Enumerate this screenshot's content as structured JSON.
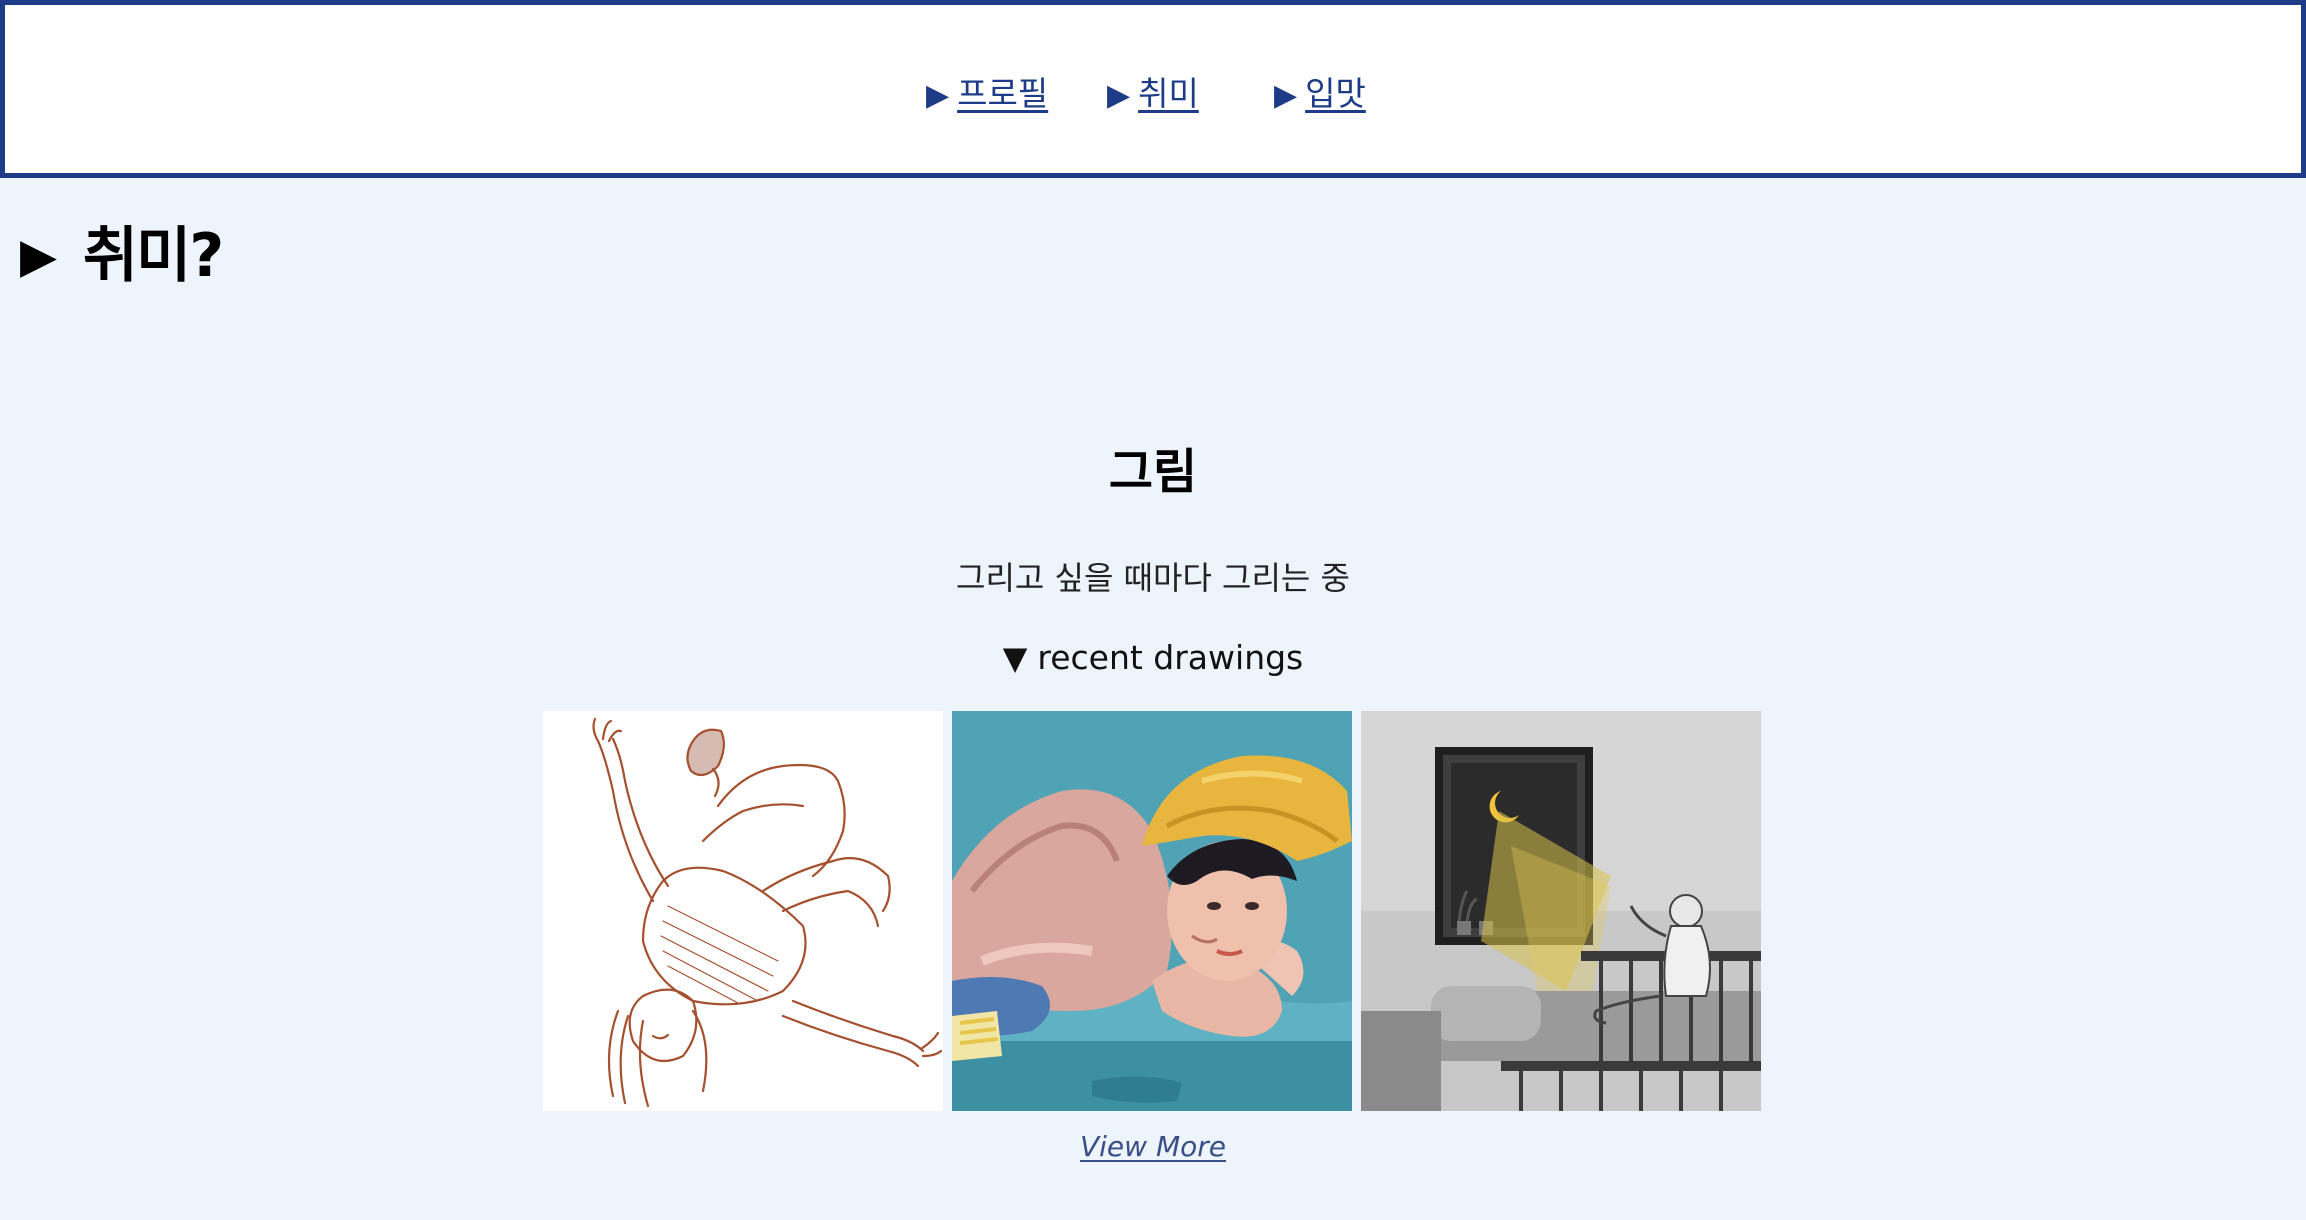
{
  "nav": {
    "items": [
      {
        "arrow": "▶",
        "label": "프로필"
      },
      {
        "arrow": "▶",
        "label": "취미"
      },
      {
        "arrow": "▶",
        "label": "입맛"
      }
    ]
  },
  "section": {
    "arrow": "▶",
    "title": "취미?"
  },
  "hobby": {
    "title": "그림",
    "description": "그리고 싶을 때마다 그리는 중",
    "recent_arrow": "▼",
    "recent_label": "recent drawings"
  },
  "gallery": {
    "images": [
      {
        "name": "sketch-falling-figure"
      },
      {
        "name": "painting-boy-yellow-hat"
      },
      {
        "name": "drawing-moonlit-room"
      }
    ]
  },
  "view_more": "View More",
  "colors": {
    "nav_border": "#1d3b86",
    "link": "#1d3b86",
    "background": "#eef4fc",
    "view_more_link": "#3a4f87"
  }
}
